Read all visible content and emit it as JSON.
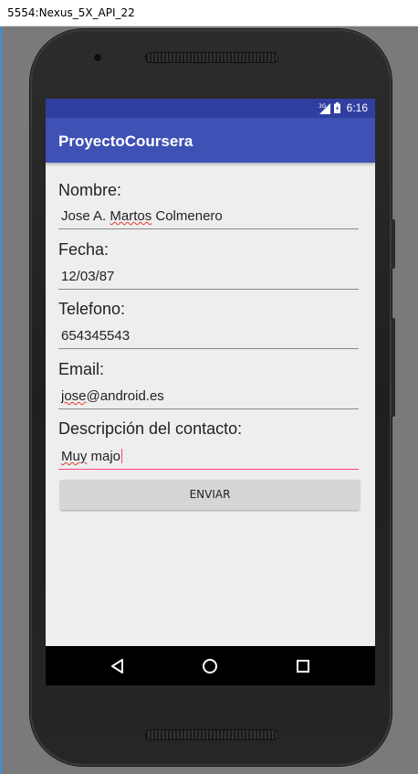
{
  "window": {
    "title": "5554:Nexus_5X_API_22"
  },
  "status_bar": {
    "network": "3G",
    "time": "6:16"
  },
  "app_bar": {
    "title": "ProyectoCoursera"
  },
  "form": {
    "fields": [
      {
        "label": "Nombre:",
        "value_parts": [
          "Jose A. ",
          "Martos",
          " Colmenero"
        ]
      },
      {
        "label": "Fecha:",
        "value": "12/03/87"
      },
      {
        "label": "Telefono:",
        "value": "654345543"
      },
      {
        "label": "Email:",
        "value_parts": [
          "jose",
          "@android.es"
        ]
      },
      {
        "label": "Descripción del contacto:",
        "value_parts": [
          "Muy",
          " majo"
        ]
      }
    ],
    "submit_label": "ENVIAR"
  },
  "nav_bar": {
    "icons": [
      "back-icon",
      "home-icon",
      "recents-icon"
    ]
  },
  "colors": {
    "status_bar": "#303f9f",
    "app_bar": "#3f51b5",
    "accent": "#ff4081",
    "screen_bg": "#eeeeee"
  }
}
